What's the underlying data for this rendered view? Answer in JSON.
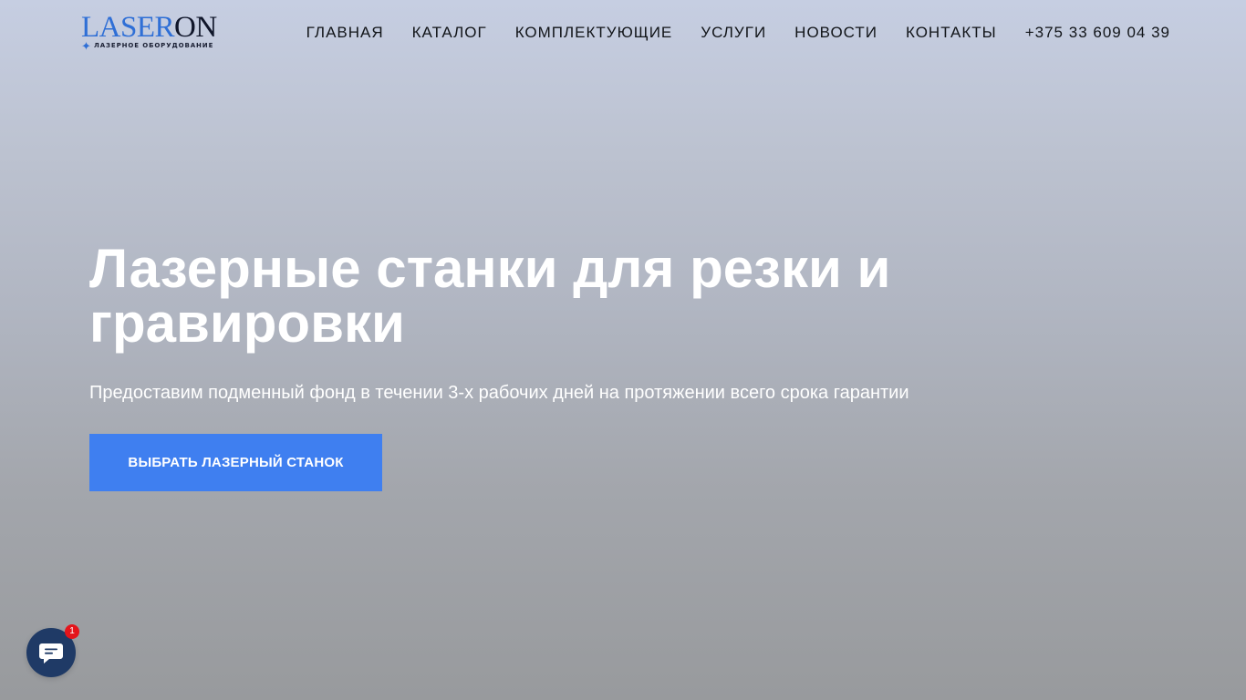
{
  "header": {
    "logo": {
      "laser": "LASER",
      "on": "ON",
      "subtitle": "ЛАЗЕРНОЕ ОБОРУДОВАНИЕ",
      "star_icon": "sparkle-icon"
    },
    "nav": [
      {
        "label": "ГЛАВНАЯ"
      },
      {
        "label": "КАТАЛОГ"
      },
      {
        "label": "КОМПЛЕКТУЮЩИЕ"
      },
      {
        "label": "УСЛУГИ"
      },
      {
        "label": "НОВОСТИ"
      },
      {
        "label": "КОНТАКТЫ"
      }
    ],
    "phone": "+375 33 609 04 39"
  },
  "hero": {
    "title": "Лазерные станки для резки и гравировки",
    "subtitle": "Предоставим подменный фонд в течении 3-х рабочих дней на протяжении всего срока гарантии",
    "cta_label": "ВЫБРАТЬ ЛАЗЕРНЫЙ СТАНОК"
  },
  "chat_widget": {
    "icon": "chat-bubble-icon",
    "badge_count": "1"
  },
  "colors": {
    "accent": "#3f7ff0",
    "logo_blue": "#2f6fd6",
    "chat_button": "#1f3a66",
    "badge_red": "#e4141b",
    "nav_text": "#111418",
    "hero_text": "#ffffff"
  }
}
